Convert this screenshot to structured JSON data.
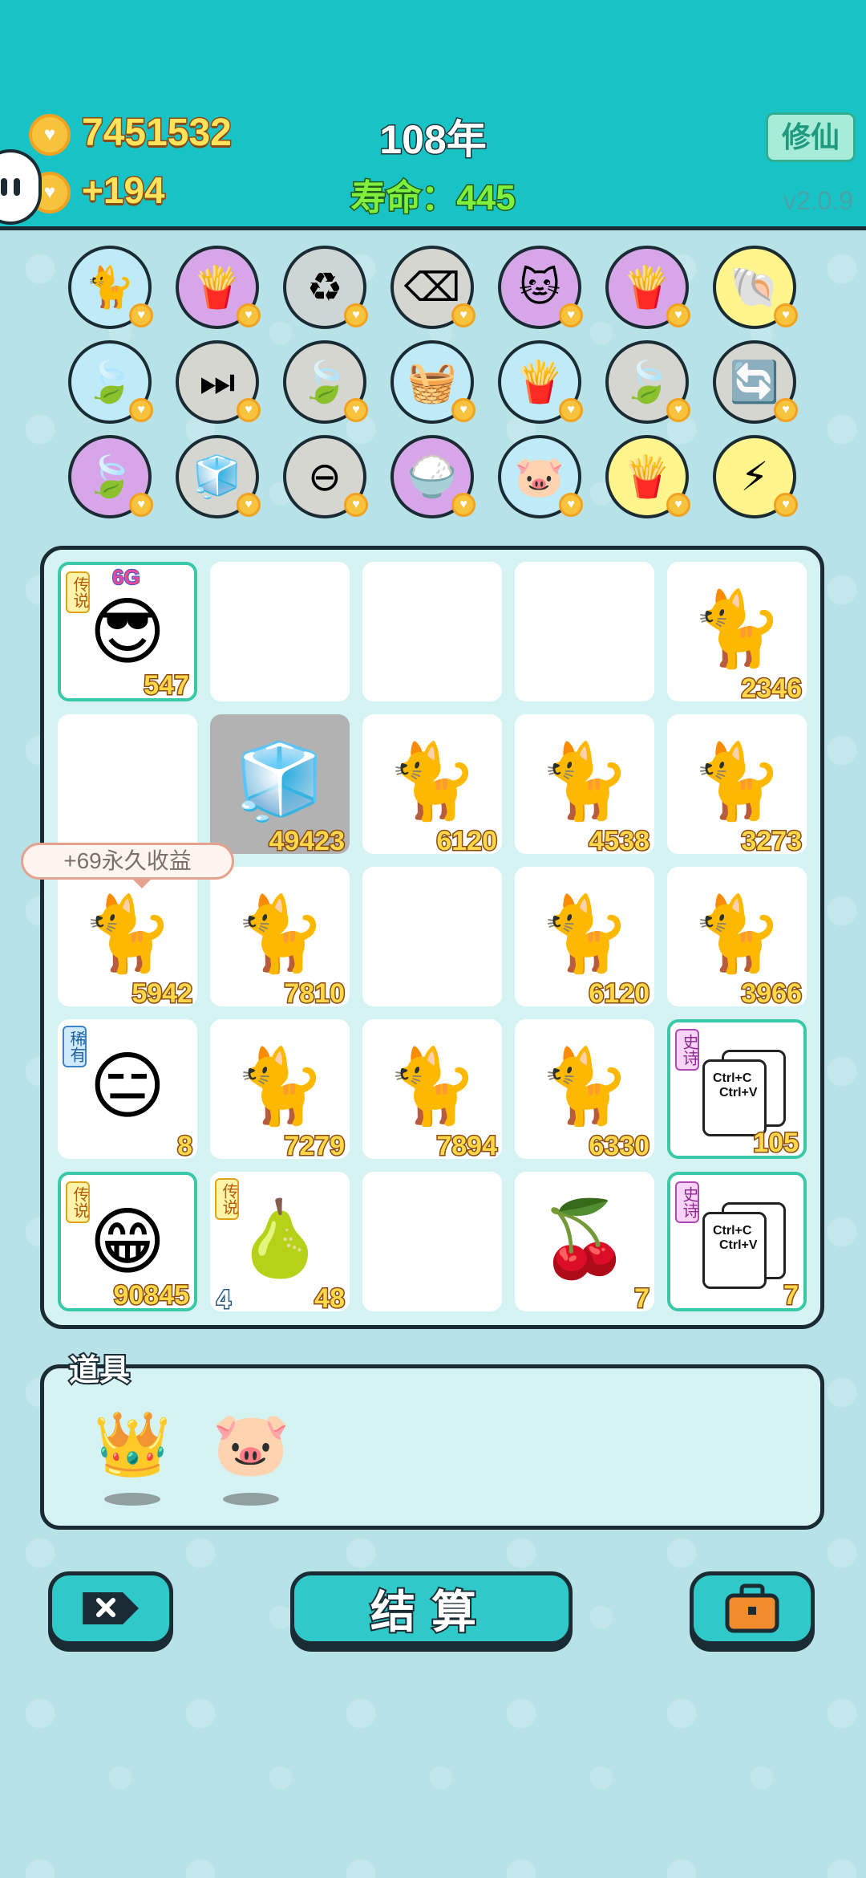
{
  "header": {
    "coins": "7451532",
    "income": "+194",
    "year": "108年",
    "life": "寿命：445",
    "mode_button": "修仙",
    "version": "v2.0.9"
  },
  "skills": [
    {
      "icon": "cat-face-icon",
      "glyph": "🐈",
      "bg": "#bfeaf8"
    },
    {
      "icon": "fries-icon",
      "glyph": "🍟",
      "bg": "#d7a6e8"
    },
    {
      "icon": "recycle-icon",
      "glyph": "♻",
      "bg": "#cdd6d5"
    },
    {
      "icon": "delete-tag-icon",
      "glyph": "⌫",
      "bg": "#d6d6d1"
    },
    {
      "icon": "double-cat-icon",
      "glyph": "🐱",
      "bg": "#d7a6e8"
    },
    {
      "icon": "fries-icon",
      "glyph": "🍟",
      "bg": "#d7a6e8"
    },
    {
      "icon": "shell-icon",
      "glyph": "🐚",
      "bg": "#fff58c"
    },
    {
      "icon": "leaf-icon",
      "glyph": "🍃",
      "bg": "#bfeaf8"
    },
    {
      "icon": "skip-icon",
      "glyph": "⏭",
      "bg": "#d6d6d1"
    },
    {
      "icon": "leaf-icon",
      "glyph": "🍃",
      "bg": "#d6d6d1"
    },
    {
      "icon": "fruit-basket-icon",
      "glyph": "🧺",
      "bg": "#bfeaf8"
    },
    {
      "icon": "fries-icon",
      "glyph": "🍟",
      "bg": "#bfeaf8"
    },
    {
      "icon": "leaf-icon",
      "glyph": "🍃",
      "bg": "#d6d6d1"
    },
    {
      "icon": "refresh-icon",
      "glyph": "🔄",
      "bg": "#d6d6d1"
    },
    {
      "icon": "leaf-icon",
      "glyph": "🍃",
      "bg": "#d7a6e8"
    },
    {
      "icon": "sugar-cubes-icon",
      "glyph": "🧊",
      "bg": "#d6d6d1"
    },
    {
      "icon": "minus-icon",
      "glyph": "⊖",
      "bg": "#d6d6d1"
    },
    {
      "icon": "rice-bowl-icon",
      "glyph": "🍚",
      "bg": "#d7a6e8"
    },
    {
      "icon": "piggy-bank-icon",
      "glyph": "🐷",
      "bg": "#bfeaf8"
    },
    {
      "icon": "fries-icon",
      "glyph": "🍟",
      "bg": "#fff58c"
    },
    {
      "icon": "lightning-icon",
      "glyph": "⚡",
      "bg": "#fff58c"
    }
  ],
  "board": [
    {
      "kind": "boss",
      "glyph": "😎",
      "count": "547",
      "tag": "传说",
      "tagType": "legend",
      "super": "6G",
      "gold": true
    },
    {
      "kind": "empty"
    },
    {
      "kind": "empty"
    },
    {
      "kind": "empty"
    },
    {
      "kind": "cat",
      "glyph": "🐈",
      "count": "2346"
    },
    {
      "kind": "empty"
    },
    {
      "kind": "fridge",
      "glyph": "🧊",
      "count": "49423",
      "grey": true
    },
    {
      "kind": "cat",
      "glyph": "🐈",
      "count": "6120"
    },
    {
      "kind": "cat",
      "glyph": "🐈",
      "count": "4538"
    },
    {
      "kind": "cat",
      "glyph": "🐈",
      "count": "3273"
    },
    {
      "kind": "cat",
      "glyph": "🐈",
      "count": "5942"
    },
    {
      "kind": "cat",
      "glyph": "🐈",
      "count": "7810"
    },
    {
      "kind": "empty"
    },
    {
      "kind": "cat",
      "glyph": "🐈",
      "count": "6120"
    },
    {
      "kind": "cat",
      "glyph": "🐈",
      "count": "3966"
    },
    {
      "kind": "man",
      "glyph": "😑",
      "count": "8",
      "tag": "稀有",
      "tagType": "rare"
    },
    {
      "kind": "cat",
      "glyph": "🐈",
      "count": "7279"
    },
    {
      "kind": "cat",
      "glyph": "🐈",
      "count": "7894"
    },
    {
      "kind": "cat",
      "glyph": "🐈",
      "count": "6330"
    },
    {
      "kind": "copy",
      "count": "105",
      "tag": "史诗",
      "tagType": "epic",
      "gold": true,
      "ctrlc": "Ctrl+C",
      "ctrlv": "Ctrl+V"
    },
    {
      "kind": "grandpa",
      "glyph": "😁",
      "count": "90845",
      "tag": "传说",
      "tagType": "legend",
      "gold": true
    },
    {
      "kind": "pear",
      "glyph": "🍐",
      "count": "48",
      "lv": "4",
      "tag": "传说",
      "tagType": "legend"
    },
    {
      "kind": "empty"
    },
    {
      "kind": "cherry",
      "glyph": "🍒",
      "count": "7"
    },
    {
      "kind": "copy",
      "count": "7",
      "tag": "史诗",
      "tagType": "epic",
      "gold": true,
      "ctrlc": "Ctrl+C",
      "ctrlv": "Ctrl+V"
    }
  ],
  "tooltip": "+69永久收益",
  "items": {
    "title": "道具",
    "list": [
      {
        "icon": "crown-icon",
        "glyph": "👑"
      },
      {
        "icon": "piggy-bank-icon",
        "glyph": "🐷"
      }
    ]
  },
  "buttons": {
    "settle": "结算"
  }
}
